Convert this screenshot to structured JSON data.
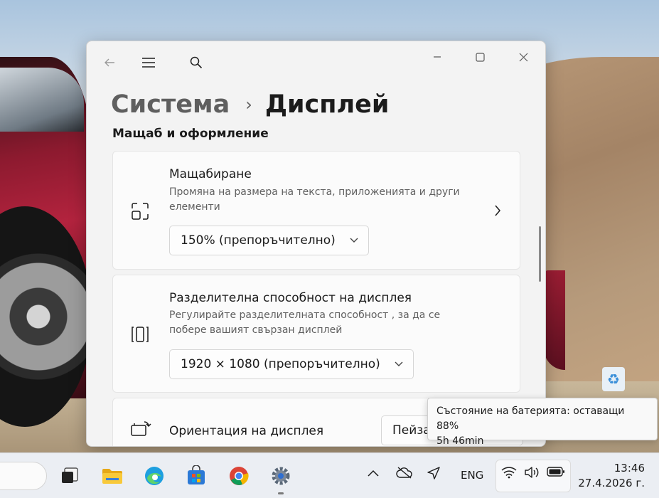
{
  "window": {
    "breadcrumb_parent": "Система",
    "breadcrumb_separator": "›",
    "breadcrumb_current": "Дисплей",
    "section_title": "Мащаб и оформление"
  },
  "scale": {
    "title": "Мащабиране",
    "description": "Промяна на размера на текста, приложенията и други елементи",
    "selected": "150% (препоръчително)",
    "icon": "scale-icon"
  },
  "resolution": {
    "title": "Разделителна способност на дисплея",
    "description": "Регулирайте разделителната способност , за да се побере вашият свързан дисплей",
    "selected": "1920 × 1080 (препоръчително)",
    "icon": "resolution-icon"
  },
  "orientation": {
    "title": "Ориентация на дисплея",
    "selected": "Пейза",
    "icon": "orientation-icon"
  },
  "tooltip": {
    "line1": "Състояние на батерията: оставащи 88%",
    "line2": "5h 46min"
  },
  "taskbar": {
    "language": "ENG",
    "time": "13:46",
    "date": "27.4.2026 г."
  },
  "colors": {
    "accent": "#0067c0",
    "window_bg": "#f3f3f3",
    "card_bg": "#fbfbfb"
  }
}
